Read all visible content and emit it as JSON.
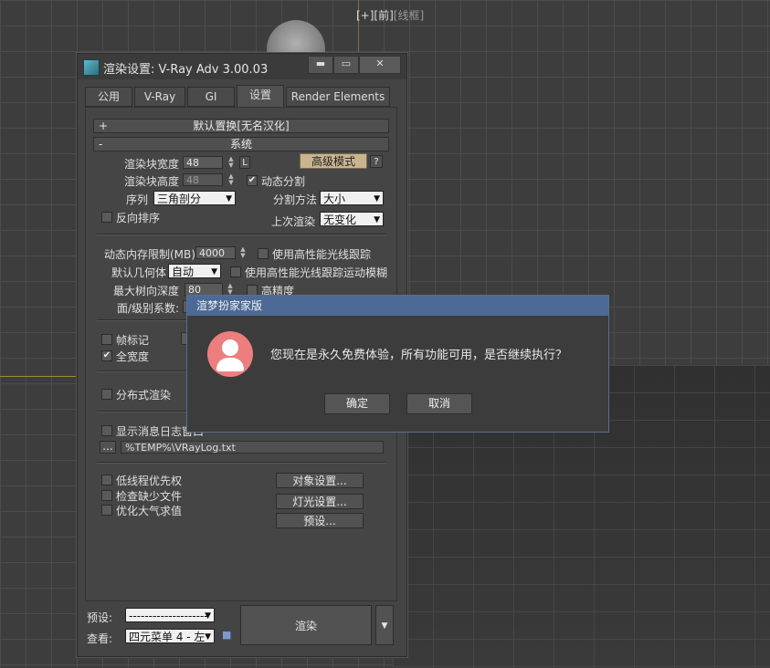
{
  "viewport": {
    "label": "[+][前][线框]",
    "label_plus": "[+][前]",
    "label_mode": "[线框]"
  },
  "window": {
    "title": "渲染设置: V-Ray Adv 3.00.03",
    "minimize": "▬",
    "maximize": "▭",
    "close": "✕",
    "tabs": [
      "公用",
      "V-Ray",
      "GI",
      "设置",
      "Render Elements"
    ],
    "active_tab": "设置"
  },
  "rollouts": {
    "default_displacement": {
      "sign": "+",
      "title": "默认置换[无名汉化]"
    },
    "system": {
      "sign": "-",
      "title": "系统"
    }
  },
  "system": {
    "bucket_width_label": "渲染块宽度",
    "bucket_width": "48",
    "lock_btn": "L",
    "bucket_height_label": "渲染块高度",
    "bucket_height": "48",
    "advanced_mode_btn": "高级模式",
    "help_btn": "?",
    "dynamic_split_label": "动态分割",
    "sequence_label": "序列",
    "sequence_value": "三角剖分",
    "split_method_label": "分割方法",
    "split_method_value": "大小",
    "reverse_label": "反向排序",
    "last_render_label": "上次渲染",
    "last_render_value": "无变化",
    "dyn_mem_label": "动态内存限制(MB)",
    "dyn_mem_value": "4000",
    "embree_label": "使用高性能光线跟踪",
    "default_geom_label": "默认几何体",
    "default_geom_value": "自动",
    "embree_motion_label": "使用高性能光线跟踪运动模糊",
    "max_tree_depth_label": "最大树向深度",
    "max_tree_depth_value": "80",
    "high_precision_label": "高精度",
    "face_level_label": "面/级别系数:",
    "frame_stamp_label": "帧标记",
    "full_width_label": "全宽度",
    "distributed_label": "分布式渲染",
    "show_log_label": "显示消息日志窗口",
    "log_path_btn": "...",
    "log_path": "%TEMP%\\VRayLog.txt",
    "low_thread_label": "低线程优先权",
    "check_missing_label": "检查缺少文件",
    "optimize_atmo_label": "优化大气求值",
    "object_settings_btn": "对象设置...",
    "light_settings_btn": "灯光设置...",
    "presets_btn": "预设..."
  },
  "footer": {
    "preset_label": "预设:",
    "preset_value": "--------------------",
    "view_label": "查看:",
    "view_value": "四元菜单 4 - 左",
    "render_btn": "渲染"
  },
  "dialog": {
    "title": "渲梦扮家家版",
    "message": "您现在是永久免费体验，所有功能可用，是否继续执行？",
    "ok": "确定",
    "cancel": "取消"
  },
  "colors": {
    "dialog_title_bg": "#4c6a95",
    "avatar": "#ec7e7e",
    "advanced_btn": "#c9b48f"
  }
}
